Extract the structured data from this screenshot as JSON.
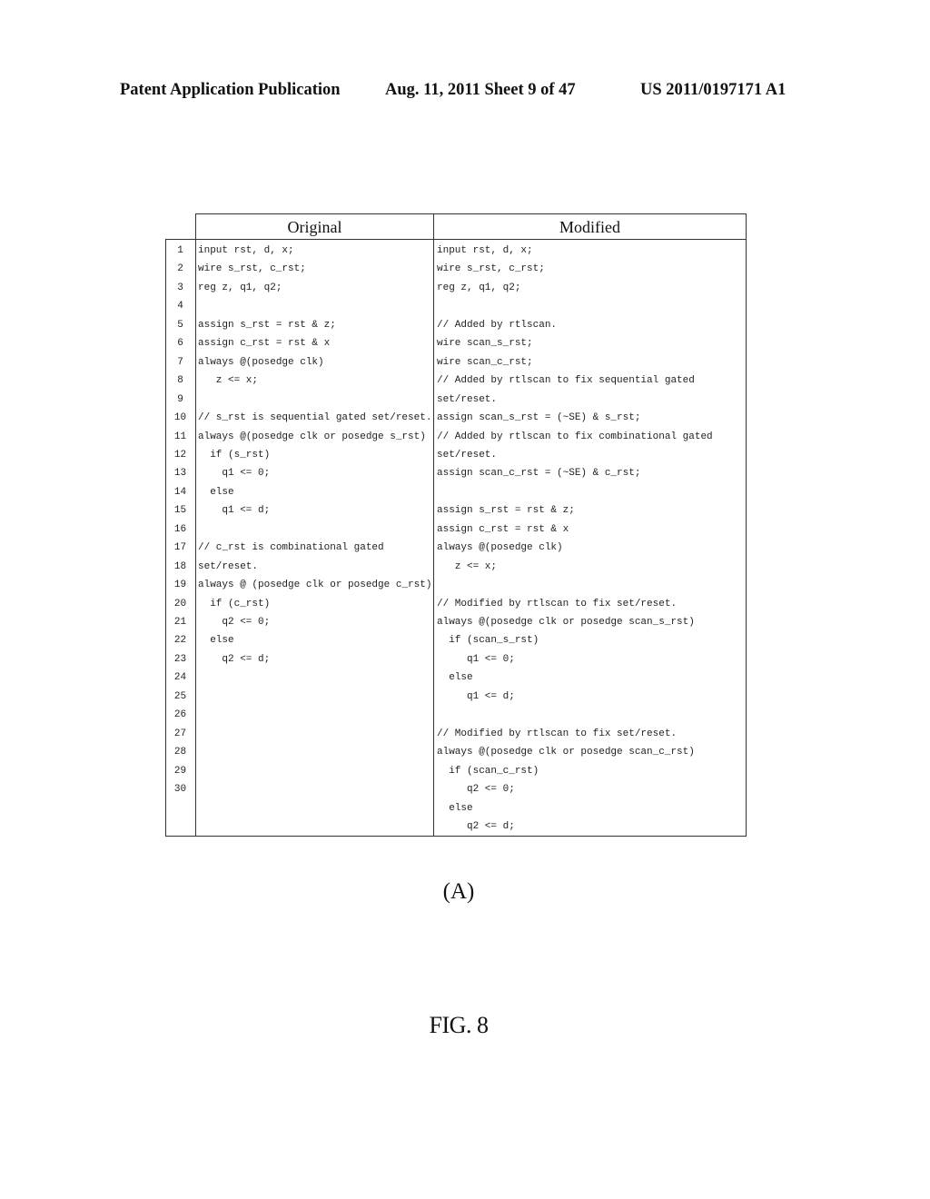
{
  "header": {
    "left": "Patent Application Publication",
    "middle": "Aug. 11, 2011  Sheet 9 of 47",
    "right": "US 2011/0197171 A1"
  },
  "table": {
    "columns": [
      "Original",
      "Modified"
    ],
    "line_numbers": [
      "1",
      "2",
      "3",
      "4",
      "5",
      "6",
      "7",
      "8",
      "9",
      "10",
      "11",
      "12",
      "13",
      "14",
      "15",
      "16",
      "17",
      "18",
      "19",
      "20",
      "21",
      "22",
      "23",
      "24",
      "25",
      "26",
      "27",
      "28",
      "29",
      "30"
    ],
    "original": [
      "input rst, d, x;",
      "wire s_rst, c_rst;",
      "reg z, q1, q2;",
      "",
      "assign s_rst = rst & z;",
      "assign c_rst = rst & x",
      "always @(posedge clk)",
      "   z <= x;",
      "",
      "// s_rst is sequential gated set/reset.",
      "always @(posedge clk or posedge s_rst)",
      "  if (s_rst)",
      "    q1 <= 0;",
      "  else",
      "    q1 <= d;",
      "",
      "// c_rst is combinational gated",
      "set/reset.",
      "always @ (posedge clk or posedge c_rst)",
      "  if (c_rst)",
      "    q2 <= 0;",
      "  else",
      "    q2 <= d;"
    ],
    "modified": [
      "input rst, d, x;",
      "wire s_rst, c_rst;",
      "reg z, q1, q2;",
      "",
      "// Added by rtlscan.",
      "wire scan_s_rst;",
      "wire scan_c_rst;",
      "// Added by rtlscan to fix sequential gated",
      "set/reset.",
      "assign scan_s_rst = (~SE) & s_rst;",
      "// Added by rtlscan to fix combinational gated",
      "set/reset.",
      "assign scan_c_rst = (~SE) & c_rst;",
      "",
      "assign s_rst = rst & z;",
      "assign c_rst = rst & x",
      "always @(posedge clk)",
      "   z <= x;",
      "",
      "// Modified by rtlscan to fix set/reset.",
      "always @(posedge clk or posedge scan_s_rst)",
      "  if (scan_s_rst)",
      "     q1 <= 0;",
      "  else",
      "     q1 <= d;",
      "",
      "// Modified by rtlscan to fix set/reset.",
      "always @(posedge clk or posedge scan_c_rst)",
      "  if (scan_c_rst)",
      "     q2 <= 0;",
      "  else",
      "     q2 <= d;"
    ]
  },
  "subfigure_label": "(A)",
  "figure_label": "FIG. 8"
}
